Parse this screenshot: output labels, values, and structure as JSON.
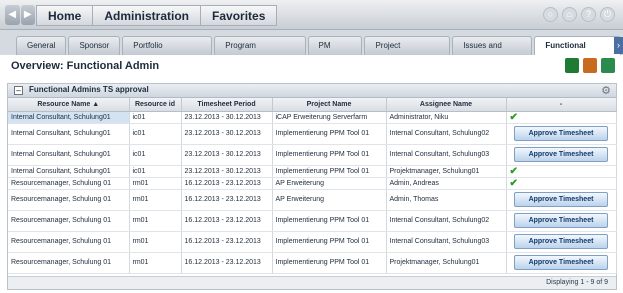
{
  "nav": {
    "back": "◀",
    "forward": "▶",
    "items": [
      "Home",
      "Administration",
      "Favorites"
    ]
  },
  "tabs": [
    "General",
    "Sponsor",
    "Portfolio Dashboard",
    "Program Dashboard",
    "PM Alerts",
    "Project Dashboard",
    "Issues and Risks",
    "Functional Admin"
  ],
  "active_tab": "Functional Admin",
  "page_title": "Overview: Functional Admin",
  "panel": {
    "title": "Functional Admins TS approval",
    "columns": [
      "Resource Name ▲",
      "Resource id",
      "Timesheet Period",
      "Project Name",
      "Assignee Name",
      "-"
    ],
    "approve_label": "Approve Timesheet",
    "check_glyph": "✔",
    "rows": [
      {
        "resource": "Internal Consultant, Schulung01",
        "id": "ic01",
        "period": "23.12.2013 - 30.12.2013",
        "project": "iCAP Erweiterung Serverfarm",
        "assignee": "Administrator, Niku",
        "status": "approved"
      },
      {
        "resource": "Internal Consultant, Schulung01",
        "id": "ic01",
        "period": "23.12.2013 - 30.12.2013",
        "project": "Implementierung PPM Tool 01",
        "assignee": "Internal Consultant, Schulung02",
        "status": "pending"
      },
      {
        "resource": "Internal Consultant, Schulung01",
        "id": "ic01",
        "period": "23.12.2013 - 30.12.2013",
        "project": "Implementierung PPM Tool 01",
        "assignee": "Internal Consultant, Schulung03",
        "status": "pending"
      },
      {
        "resource": "Internal Consultant, Schulung01",
        "id": "ic01",
        "period": "23.12.2013 - 30.12.2013",
        "project": "Implementierung PPM Tool 01",
        "assignee": "Projektmanager, Schulung01",
        "status": "approved"
      },
      {
        "resource": "Resourcemanager, Schulung 01",
        "id": "rm01",
        "period": "16.12.2013 - 23.12.2013",
        "project": "AP Erweiterung",
        "assignee": "Admin, Andreas",
        "status": "approved"
      },
      {
        "resource": "Resourcemanager, Schulung 01",
        "id": "rm01",
        "period": "16.12.2013 - 23.12.2013",
        "project": "AP Erweiterung",
        "assignee": "Admin, Thomas",
        "status": "pending"
      },
      {
        "resource": "Resourcemanager, Schulung 01",
        "id": "rm01",
        "period": "16.12.2013 - 23.12.2013",
        "project": "Implementierung PPM Tool 01",
        "assignee": "Internal Consultant, Schulung02",
        "status": "pending"
      },
      {
        "resource": "Resourcemanager, Schulung 01",
        "id": "rm01",
        "period": "16.12.2013 - 23.12.2013",
        "project": "Implementierung PPM Tool 01",
        "assignee": "Internal Consultant, Schulung03",
        "status": "pending"
      },
      {
        "resource": "Resourcemanager, Schulung 01",
        "id": "rm01",
        "period": "16.12.2013 - 23.12.2013",
        "project": "Implementierung PPM Tool 01",
        "assignee": "Projektmanager, Schulung01",
        "status": "pending"
      }
    ]
  },
  "status_text": "Displaying 1 - 9 of 9",
  "colors": {
    "accent": "#4b6ea5",
    "check": "#2a9a2a",
    "approve_border": "#7f9fc4"
  }
}
